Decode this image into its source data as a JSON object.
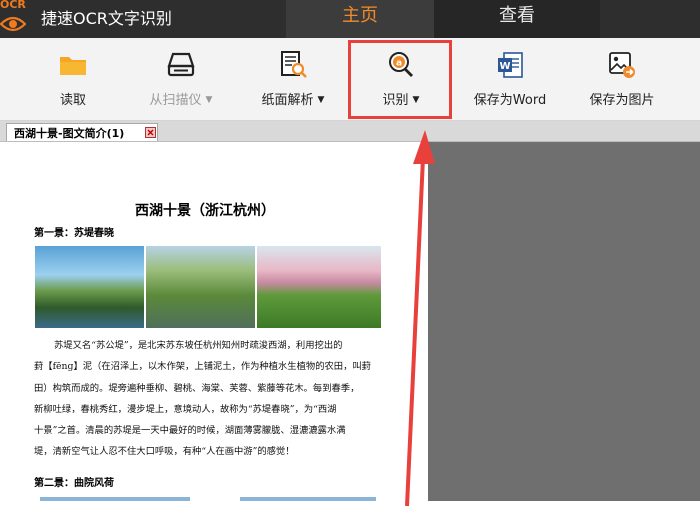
{
  "app": {
    "logo_text": "OCR",
    "title": "捷速OCR文字识别"
  },
  "tabs": [
    {
      "label": "主页",
      "active": true
    },
    {
      "label": "查看",
      "active": false
    }
  ],
  "toolbar": {
    "read": {
      "label": "读取",
      "icon": "folder-icon"
    },
    "scan": {
      "label": "从扫描仪",
      "icon": "scanner-icon",
      "disabled": true
    },
    "parse": {
      "label": "纸面解析",
      "icon": "document-magnify-icon"
    },
    "recognize": {
      "label": "识别",
      "icon": "recognize-icon"
    },
    "save_word": {
      "label": "保存为Word",
      "icon": "word-icon"
    },
    "save_image": {
      "label": "保存为图片",
      "icon": "image-icon"
    },
    "dropdown_arrow": "▼"
  },
  "doc_tab": {
    "label": "西湖十景-图文简介(1)"
  },
  "document": {
    "title": "西湖十景（浙江杭州）",
    "section1": "第一景：苏堤春晓",
    "paragraph_lines": [
      "苏堤又名“苏公堤”，是北宋苏东坡任杭州知州时疏浚西湖，利用挖出的",
      "葑【fēng】泥（在沼泽上，以木作架，上铺泥土，作为种植水生植物的农田，叫葑",
      "田）构筑而成的。堤旁遍种垂柳、碧桃、海棠、芙蓉、紫藤等花木。每到春季，",
      "新柳吐绿，春桃秀红，漫步堤上，意境动人，故称为“苏堤春晓”，为“西湖",
      "十景”之首。清晨的苏堤是一天中最好的时候，湖面薄雾朦胧、湿漉漉露水满",
      "堤，清新空气让人忍不住大口呼吸，有种“人在画中游”的感觉！"
    ],
    "section2": "第二景：曲院风荷"
  },
  "colors": {
    "accent": "#f08a2a",
    "highlight": "#e8413c",
    "titlebar": "#2e2e2e"
  }
}
